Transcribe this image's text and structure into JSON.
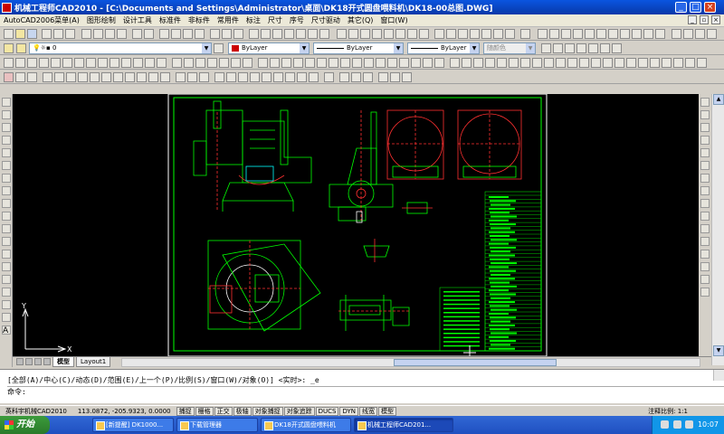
{
  "window": {
    "title": "机械工程师CAD2010 - [C:\\Documents and Settings\\Administrator\\桌面\\DK18开式圆盘喂料机\\DK18-00总图.DWG]"
  },
  "menu": [
    "AutoCAD2006菜单(A)",
    "图形绘制",
    "设计工具",
    "标准件",
    "非标件",
    "常用件",
    "标注",
    "尺寸",
    "序号",
    "尺寸驱动",
    "其它(Q)",
    "窗口(W)"
  ],
  "toolbar": {
    "layer_value": "0",
    "color_value": "ByLayer",
    "linetype_value": "ByLayer",
    "lineweight_value": "ByLayer",
    "plotstyle_value": "随颜色"
  },
  "layout_tabs": [
    "模型",
    "Layout1"
  ],
  "command": {
    "line1": "[全部(A)/中心(C)/动态(D)/范围(E)/上一个(P)/比例(S)/窗口(W)/对象(O)] <实时>: _e",
    "line2": "命令:"
  },
  "status": {
    "app_label": "英科宇机械CAD2010",
    "coordinates": "113.0872, -205.9323, 0.0000",
    "toggles": [
      "捕捉",
      "栅格",
      "正交",
      "极轴",
      "对象捕捉",
      "对象追踪",
      "DUCS",
      "DYN",
      "线宽",
      "模型"
    ],
    "scale_label": "注释比例: 1:1"
  },
  "taskbar": {
    "start": "开始",
    "tasks": [
      "[新提醒] DK1000...",
      "下载管理器",
      "DK18开式圆盘喂料机",
      "机械工程师CAD201..."
    ],
    "clock": "10:07"
  },
  "colors": {
    "canvas_bg": "#000000",
    "drawing": "#00ff00",
    "accent_red": "#ff3030",
    "frame": "#ffffff"
  },
  "icons": [
    "new-icon",
    "open-icon",
    "save-icon",
    "print-icon",
    "undo-icon",
    "redo-icon",
    "pan-icon",
    "zoom-icon",
    "layer-icon",
    "line-icon",
    "circle-icon",
    "arc-icon",
    "rectangle-icon",
    "hatch-icon",
    "text-icon",
    "move-icon",
    "copy-icon",
    "erase-icon"
  ]
}
